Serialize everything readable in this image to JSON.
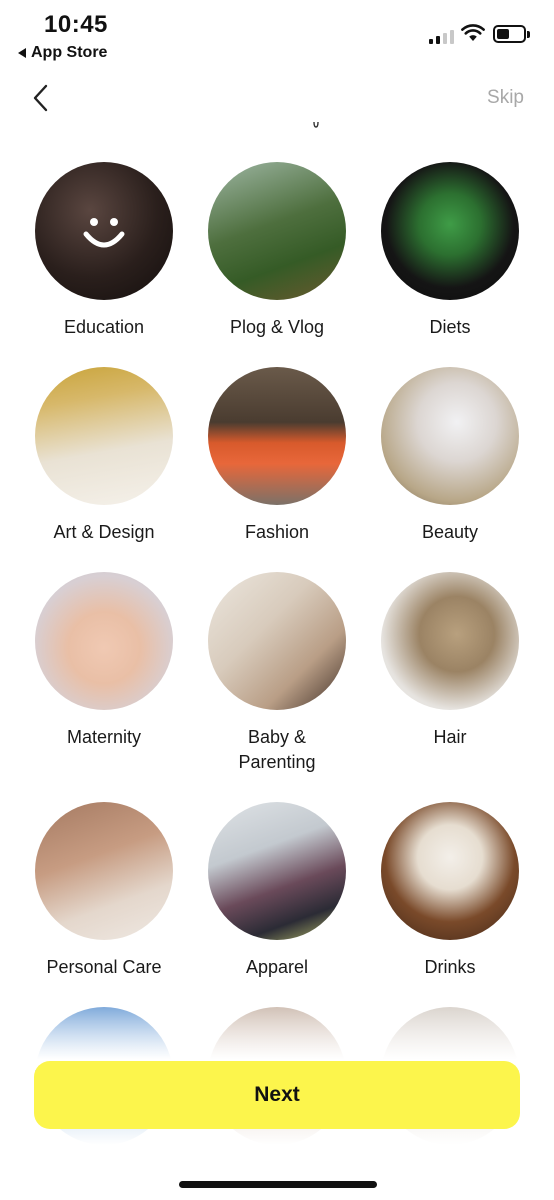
{
  "status_bar": {
    "time": "10:45",
    "back_app_label": "App Store"
  },
  "nav": {
    "skip_label": "Skip"
  },
  "categories": [
    {
      "label": "Education"
    },
    {
      "label": "Plog & Vlog"
    },
    {
      "label": "Diets"
    },
    {
      "label": "Art & Design"
    },
    {
      "label": "Fashion"
    },
    {
      "label": "Beauty"
    },
    {
      "label": "Maternity"
    },
    {
      "label": "Baby & Parenting"
    },
    {
      "label": "Hair"
    },
    {
      "label": "Personal Care"
    },
    {
      "label": "Apparel"
    },
    {
      "label": "Drinks"
    }
  ],
  "footer": {
    "next_label": "Next"
  },
  "colors": {
    "accent": "#fcf54c",
    "skip_text": "#a8a8a8"
  }
}
